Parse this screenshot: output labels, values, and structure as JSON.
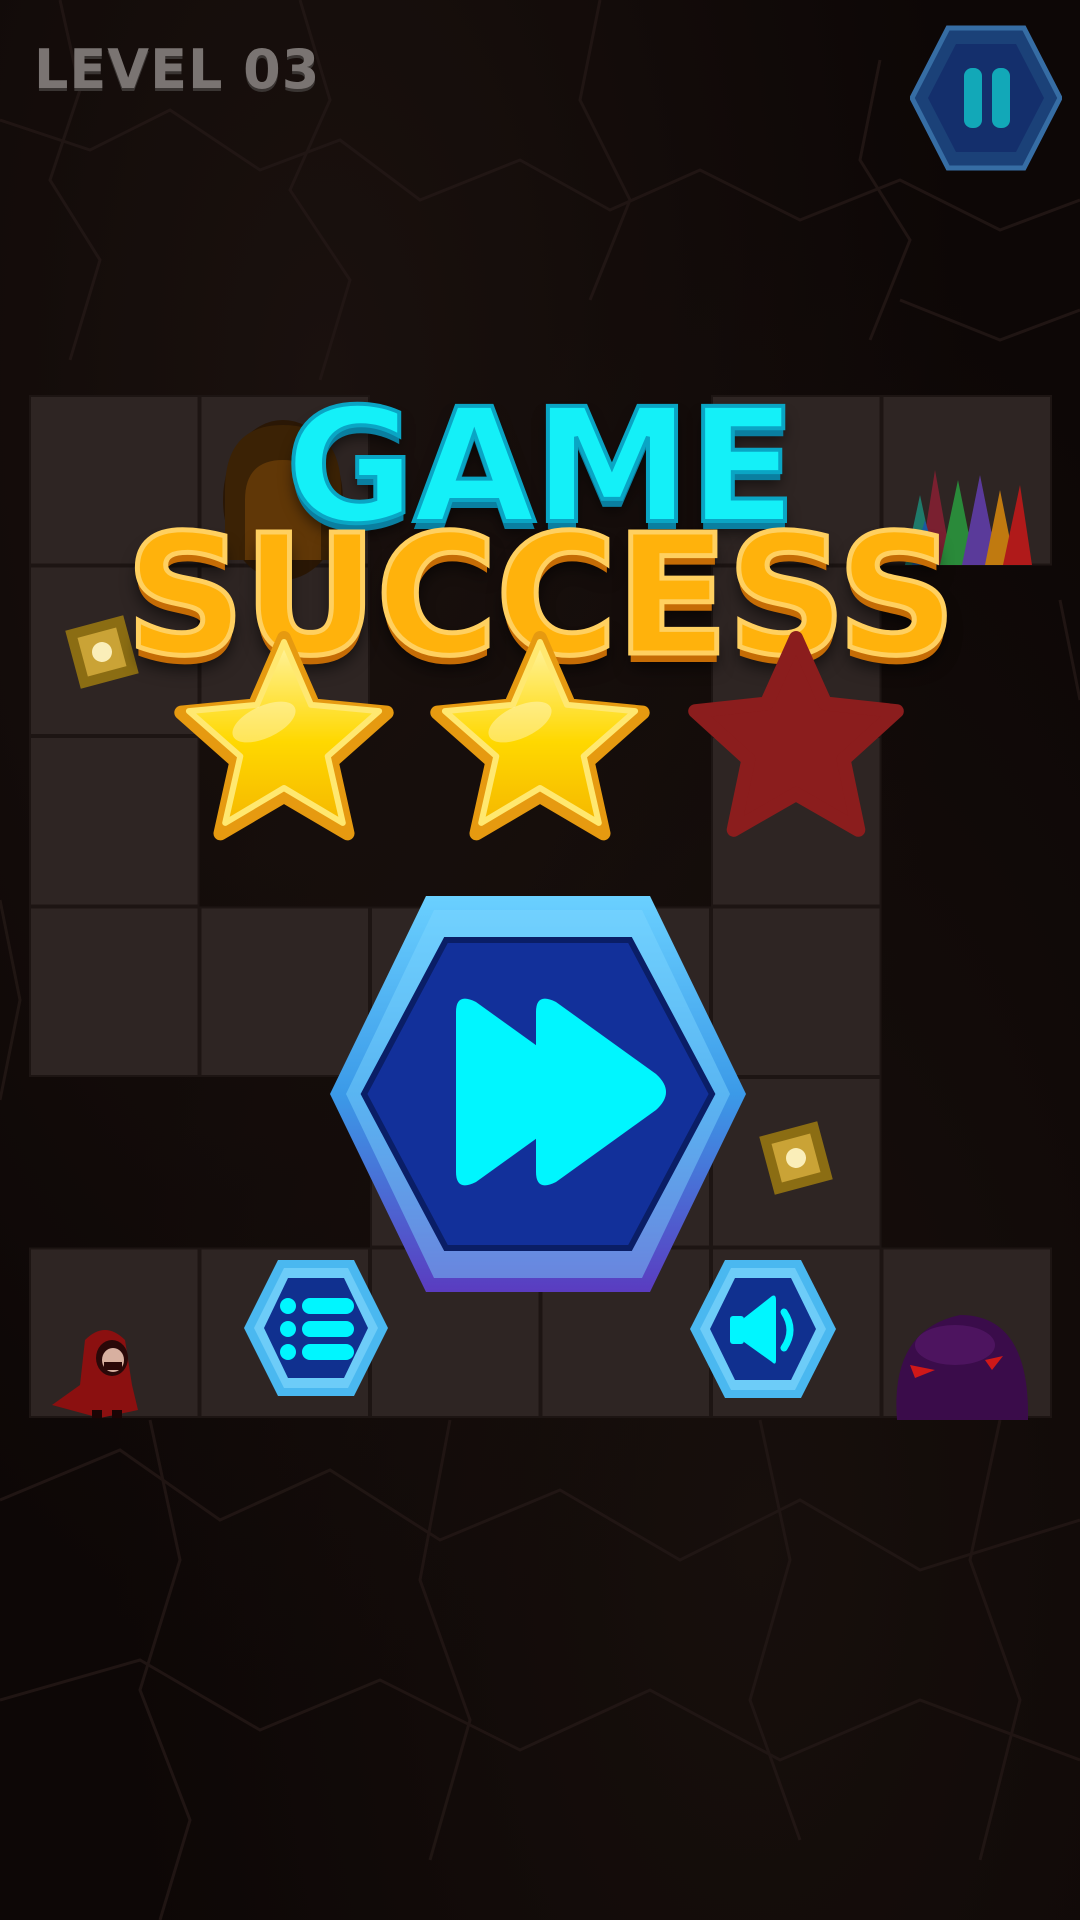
{
  "hud": {
    "level_label": "LEVEL 03",
    "pause_icon": "pause-icon"
  },
  "result": {
    "title_line1": "GAME",
    "title_line2": "SUCCESS",
    "stars_earned": 2,
    "stars_total": 3
  },
  "buttons": {
    "next_icon": "fast-forward-icon",
    "menu_icon": "list-menu-icon",
    "sound_icon": "speaker-icon"
  },
  "board": {
    "rows": 6,
    "cols": 6,
    "entities": [
      "hooded-hero",
      "purple-slime-enemy",
      "gold-gem",
      "gold-gem",
      "crystal-spikes",
      "cave-exit-door"
    ]
  },
  "colors": {
    "background": "#0d0706",
    "tile": "#2e2523",
    "level_text": "#7a7472",
    "title_game": "#14f0f8",
    "title_success": "#ffb20c",
    "star_gold": "#ffd700",
    "star_empty": "#8b1d1d",
    "button_frame": "#4ab8f0",
    "button_face": "#10308f",
    "button_icon": "#00f6ff"
  }
}
